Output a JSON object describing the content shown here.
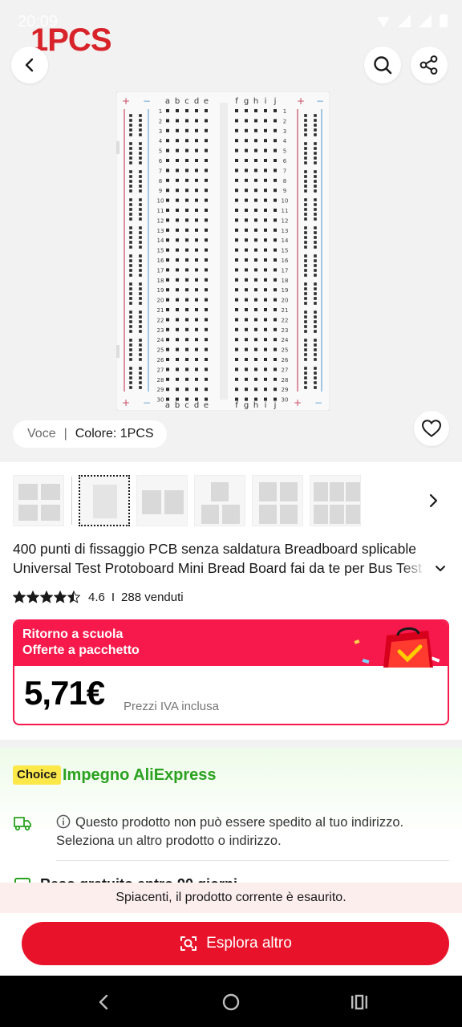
{
  "status_bar": {
    "time": "20:09"
  },
  "hero": {
    "brand_badge": "1PCS",
    "board": {
      "columns_left": [
        "a",
        "b",
        "c",
        "d",
        "e"
      ],
      "columns_right": [
        "f",
        "g",
        "h",
        "i",
        "j"
      ],
      "row_count": 30,
      "rail_plus": "+",
      "rail_minus": "−"
    }
  },
  "variant": {
    "label": "Voce",
    "separator": "|",
    "value": "Colore: 1PCS"
  },
  "thumbnails": {
    "count": 6,
    "active_index": 1
  },
  "product": {
    "title": "400 punti di fissaggio PCB senza saldatura Breadboard splicable Universal Test Protoboard Mini Bread Board fai da te per Bus Test",
    "rating": "4.6",
    "rating_separator": "I",
    "sold": "288 venduti",
    "stars_filled": 4.5
  },
  "promo": {
    "line1": "Ritorno a scuola",
    "line2": "Offerte a pacchetto",
    "price": "5,71€",
    "price_note": "Prezzi IVA inclusa"
  },
  "choice": {
    "badge": "Choice",
    "title": "Impegno AliExpress",
    "shipping_line1": "Questo prodotto non può essere spedito al tuo indirizzo.",
    "shipping_line2": "Seleziona un altro prodotto o indirizzo.",
    "next_row": "Reso gratuito entro 90 giorni"
  },
  "soldout_message": "Spiacenti, il prodotto corrente è esaurito.",
  "explore_button": "Esplora altro",
  "colors": {
    "accent": "#e8132a",
    "promo": "#f7194c",
    "choice_green": "#2aa21f",
    "choice_badge": "#fde84a"
  }
}
